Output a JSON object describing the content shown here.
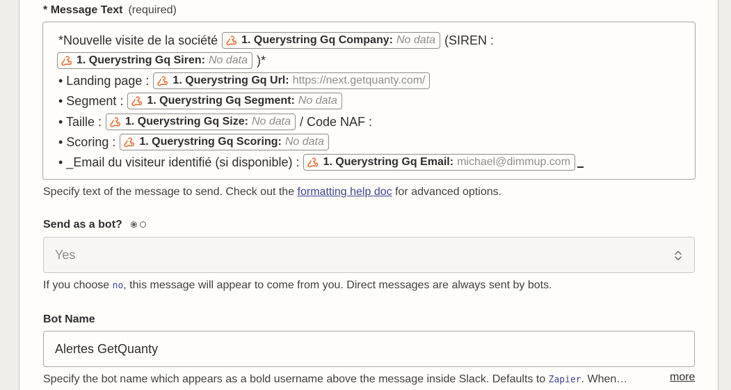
{
  "message_text": {
    "label": "Message Text",
    "required_marker": "*",
    "required_text": "(required)",
    "lines": [
      {
        "parts": [
          {
            "type": "text",
            "value": "*Nouvelle visite de la société"
          },
          {
            "type": "pill",
            "key": "1. Querystring Gq Company:",
            "value": "No data",
            "empty": true
          },
          {
            "type": "text",
            "value": "(SIREN :"
          }
        ]
      },
      {
        "parts": [
          {
            "type": "pill",
            "key": "1. Querystring Gq Siren:",
            "value": "No data",
            "empty": true
          },
          {
            "type": "text",
            "value": ")*"
          }
        ]
      },
      {
        "parts": [
          {
            "type": "text",
            "value": "• Landing page :"
          },
          {
            "type": "pill",
            "key": "1. Querystring Gq Url:",
            "value": "https://next.getquanty.com/",
            "empty": false
          }
        ]
      },
      {
        "parts": [
          {
            "type": "text",
            "value": "• Segment :"
          },
          {
            "type": "pill",
            "key": "1. Querystring Gq Segment:",
            "value": "No data",
            "empty": true
          }
        ]
      },
      {
        "parts": [
          {
            "type": "text",
            "value": "• Taille :"
          },
          {
            "type": "pill",
            "key": "1. Querystring Gq Size:",
            "value": "No data",
            "empty": true
          },
          {
            "type": "text",
            "value": "/ Code NAF :"
          }
        ]
      },
      {
        "parts": [
          {
            "type": "text",
            "value": "• Scoring :"
          },
          {
            "type": "pill",
            "key": "1. Querystring Gq Scoring:",
            "value": "No data",
            "empty": true
          }
        ]
      },
      {
        "parts": [
          {
            "type": "text",
            "value": "• _Email du visiteur identifié (si disponible) :"
          },
          {
            "type": "pill",
            "key": "1. Querystring Gq Email:",
            "value": "michael@dimmup.com",
            "empty": false
          },
          {
            "type": "cursor",
            "value": "_"
          }
        ]
      }
    ],
    "help_before": "Specify text of the message to send. Check out the ",
    "help_link": "formatting help doc",
    "help_after": " for advanced options."
  },
  "send_as_bot": {
    "label": "Send as a bot?",
    "value": "Yes",
    "help_before": "If you choose ",
    "help_code": "no",
    "help_after": ", this message will appear to come from you. Direct messages are always sent by bots."
  },
  "bot_name": {
    "label": "Bot Name",
    "value": "Alertes GetQuanty",
    "help_before": "Specify the bot name which appears as a bold username above the message inside Slack. Defaults to ",
    "help_code": "Zapier",
    "help_after": ". When…",
    "more_label": "more"
  },
  "colors": {
    "hook_icon": "#e0672b",
    "link": "#3d4592",
    "panel_bg": "#fffdf9",
    "page_bg": "#efeee9"
  },
  "icons": {
    "pill_icon": "webhook-icon",
    "select_icon": "chevron-updown-icon"
  }
}
